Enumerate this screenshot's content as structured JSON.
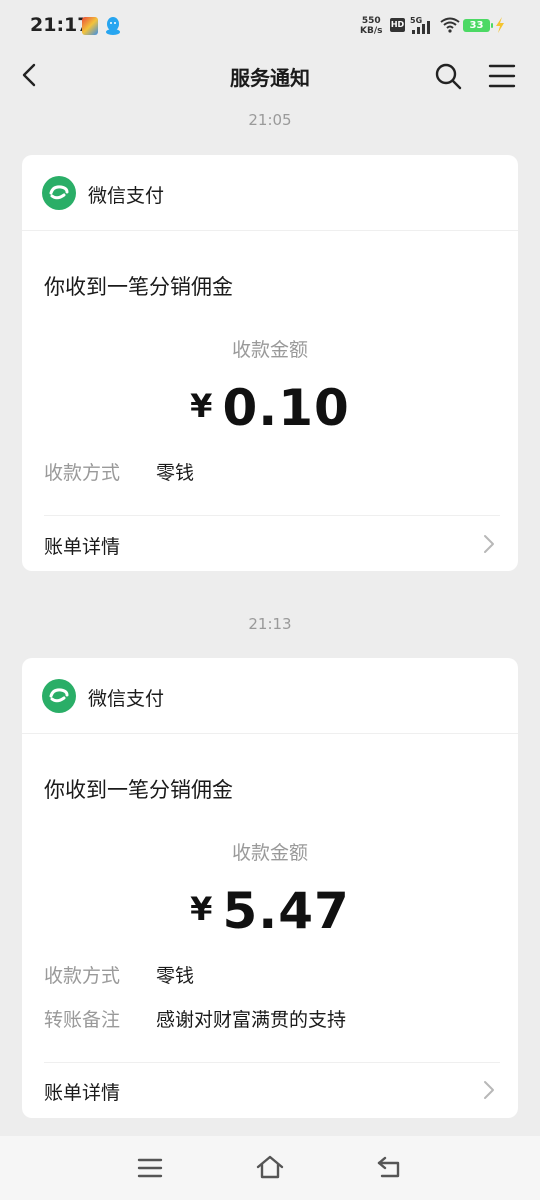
{
  "status_bar": {
    "time": "21:17",
    "net_speed_value": "550",
    "net_speed_unit": "KB/s",
    "hd_badge": "HD",
    "signal_label": "5G",
    "battery": "33"
  },
  "nav": {
    "title": "服务通知"
  },
  "messages": [
    {
      "timestamp": "21:05",
      "brand": "微信支付",
      "title": "你收到一笔分销佣金",
      "amount_label": "收款金额",
      "currency": "¥",
      "amount": "0.10",
      "fields": [
        {
          "key": "收款方式",
          "value": "零钱"
        }
      ],
      "detail_label": "账单详情"
    },
    {
      "timestamp": "21:13",
      "brand": "微信支付",
      "title": "你收到一笔分销佣金",
      "amount_label": "收款金额",
      "currency": "¥",
      "amount": "5.47",
      "fields": [
        {
          "key": "收款方式",
          "value": "零钱"
        },
        {
          "key": "转账备注",
          "value": "感谢对财富满贯的支持"
        }
      ],
      "detail_label": "账单详情"
    }
  ],
  "colors": {
    "background": "#ededed",
    "card": "#ffffff",
    "wechat_pay_green": "#2aae67",
    "muted_text": "#9a9a9a"
  }
}
